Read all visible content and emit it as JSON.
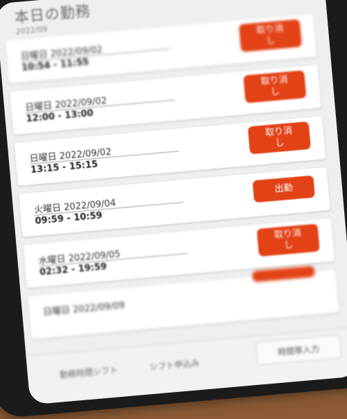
{
  "header": {
    "title": "本日の勤務",
    "subtitle": "2022/09"
  },
  "shifts": [
    {
      "day": "日曜日",
      "date": "2022/09/02",
      "time": "10:54 - 11:55",
      "action": "取り消し"
    },
    {
      "day": "日曜日",
      "date": "2022/09/02",
      "time": "12:00 - 13:00",
      "action": "取り消し"
    },
    {
      "day": "日曜日",
      "date": "2022/09/02",
      "time": "13:15 - 15:15",
      "action": "取り消し"
    },
    {
      "day": "火曜日",
      "date": "2022/09/04",
      "time": "09:59 - 10:59",
      "action": "出勤"
    },
    {
      "day": "水曜日",
      "date": "2022/09/05",
      "time": "02:32 - 19:59",
      "action": "取り消し"
    },
    {
      "day": "日曜日",
      "date": "2022/09/09",
      "time": "",
      "action": ""
    }
  ],
  "bottom_nav": {
    "item1": "勤務時間シフト",
    "item2": "シフト申込み",
    "button": "時間帯入力"
  },
  "colors": {
    "accent": "#e34216",
    "card": "#ffffff",
    "background": "#efefef"
  }
}
